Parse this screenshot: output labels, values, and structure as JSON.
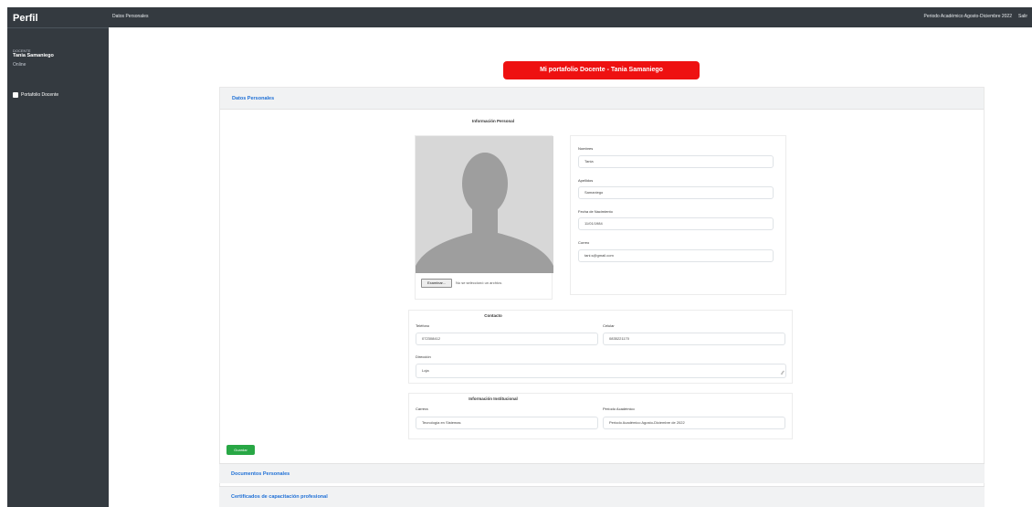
{
  "sidebar": {
    "brand": "Perfil",
    "user_role": "DOCENTE",
    "user_name": "Tania Samaniego",
    "user_status": "Online",
    "nav_items": [
      {
        "label": "Portafolio Docente",
        "icon": "folder-icon"
      }
    ]
  },
  "navbar": {
    "title": "Datos Personales",
    "right_text": "Periodo Académico Agosto-Diciembre 2022",
    "salir": "Salir"
  },
  "portfolio_title": "Mi portafolio Docente - Tania Samaniego",
  "datos_personales": {
    "header": "Datos Personales",
    "info_title": "Información Personal",
    "file_button": "Examinar...",
    "file_status": "No se seleccionó un archivo.",
    "fields": [
      {
        "label": "Nombres",
        "value": "Tania"
      },
      {
        "label": "Apellidos",
        "value": "Samaniego"
      },
      {
        "label": "Fecha de Nacimiento",
        "value": "11/01/1984"
      },
      {
        "label": "Correo",
        "value": "tani.s@gmail.com"
      }
    ],
    "contacto": {
      "title": "Contacto",
      "telefono_label": "Teléfono",
      "telefono_value": "072308412",
      "celular_label": "Celular",
      "celular_value": "0835221170",
      "direccion_label": "Dirección",
      "direccion_value": "Loja"
    },
    "institucional": {
      "title": "Información Institucional",
      "carrera_label": "Carrera",
      "carrera_value": "Tecnología en Sistemas",
      "periodo_label": "Período Académico",
      "periodo_value": "Periodo Académico Agosto-Diciembre de 2022"
    },
    "save_button": "Guardar"
  },
  "sections": [
    {
      "label": "Documentos Personales"
    },
    {
      "label": "Certificados de capacitación profesional"
    }
  ],
  "colors": {
    "sidebar_bg": "#343a40",
    "title_bg": "#ee1111",
    "link": "#1f70d6",
    "save": "#28a745"
  }
}
